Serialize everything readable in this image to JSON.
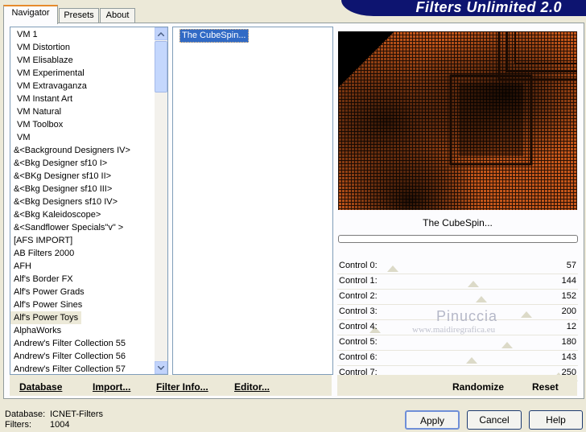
{
  "tabs": [
    {
      "label": "Navigator",
      "active": true
    },
    {
      "label": "Presets",
      "active": false
    },
    {
      "label": "About",
      "active": false
    }
  ],
  "banner": {
    "title": "Filters Unlimited 2.0"
  },
  "categories": [
    "VM 1",
    "VM Distortion",
    "VM Elisablaze",
    "VM Experimental",
    "VM Extravaganza",
    "VM Instant Art",
    "VM Natural",
    "VM Toolbox",
    "VM",
    "&<Background Designers IV>",
    "&<Bkg Designer sf10 I>",
    "&<BKg Designer sf10 II>",
    "&<Bkg Designer sf10 III>",
    "&<Bkg Designers sf10 IV>",
    "&<Bkg Kaleidoscope>",
    "&<Sandflower Specials\"v\" >",
    "[AFS IMPORT]",
    "AB Filters 2000",
    "AFH",
    "Alf's Border FX",
    "Alf's Power Grads",
    "Alf's Power Sines",
    "Alf's Power Toys",
    "AlphaWorks",
    "Andrew's Filter Collection 55",
    "Andrew's Filter Collection 56",
    "Andrew's Filter Collection 57"
  ],
  "selected_category": "Alf's Power Toys",
  "filters": [
    "The CubeSpin..."
  ],
  "selected_filter_name": "The CubeSpin...",
  "controls": [
    {
      "label": "Control 0:",
      "value": "57"
    },
    {
      "label": "Control 1:",
      "value": "144"
    },
    {
      "label": "Control 2:",
      "value": "152"
    },
    {
      "label": "Control 3:",
      "value": "200"
    },
    {
      "label": "Control 4:",
      "value": "12"
    },
    {
      "label": "Control 5:",
      "value": "180"
    },
    {
      "label": "Control 6:",
      "value": "143"
    },
    {
      "label": "Control 7:",
      "value": "250"
    }
  ],
  "watermark": {
    "line1": "Pinuccia",
    "line2": "www.maidiregrafica.eu"
  },
  "left_toolbar": {
    "database": "Database",
    "import": "Import...",
    "filter_info": "Filter Info...",
    "editor": "Editor..."
  },
  "right_toolbar": {
    "randomize": "Randomize",
    "reset": "Reset"
  },
  "status": {
    "db_label": "Database:",
    "db_value": "ICNET-Filters",
    "filters_label": "Filters:",
    "filters_value": "1004"
  },
  "buttons": {
    "apply": "Apply",
    "cancel": "Cancel",
    "help": "Help"
  },
  "colors": {
    "selection": "#316ac5",
    "banner": "#0d1470",
    "tab_accent": "#e68b2c",
    "preview_orange": "#c4561a"
  }
}
